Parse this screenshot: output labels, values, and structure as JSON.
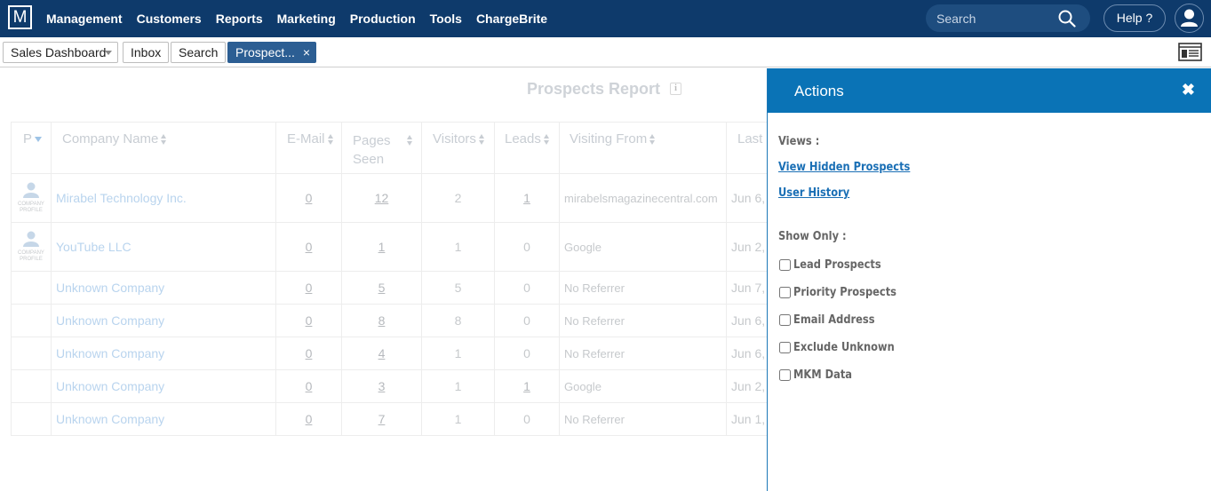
{
  "topbar": {
    "logo": "M",
    "nav": [
      "Management",
      "Customers",
      "Reports",
      "Marketing",
      "Production",
      "Tools",
      "ChargeBrite"
    ],
    "search_placeholder": "Search",
    "help_label": "Help ?"
  },
  "tabs": {
    "dropdown": "Sales Dashboard",
    "inbox": "Inbox",
    "search": "Search",
    "active": "Prospect...",
    "active_close": "×"
  },
  "report": {
    "title": "Prospects Report",
    "info": "i",
    "columns": [
      "P",
      "Company Name",
      "E-Mail",
      "Pages Seen",
      "Visitors",
      "Leads",
      "Visiting From",
      "Last"
    ],
    "profile_caption": [
      "COMPANY",
      "PROFILE"
    ],
    "rows": [
      {
        "company": "Mirabel Technology Inc.",
        "email": "0",
        "pages": "12",
        "visitors": "2",
        "leads": "1",
        "from": "mirabelsmagazinecentral.com",
        "date": "Jun 6,",
        "profile": true,
        "leads_link": true
      },
      {
        "company": "YouTube LLC",
        "email": "0",
        "pages": "1",
        "visitors": "1",
        "leads": "0",
        "from": "Google",
        "date": "Jun 2,",
        "profile": true,
        "leads_link": false
      },
      {
        "company": "Unknown Company",
        "email": "0",
        "pages": "5",
        "visitors": "5",
        "leads": "0",
        "from": "No Referrer",
        "date": "Jun 7,",
        "profile": false,
        "leads_link": false
      },
      {
        "company": "Unknown Company",
        "email": "0",
        "pages": "8",
        "visitors": "8",
        "leads": "0",
        "from": "No Referrer",
        "date": "Jun 6,",
        "profile": false,
        "leads_link": false
      },
      {
        "company": "Unknown Company",
        "email": "0",
        "pages": "4",
        "visitors": "1",
        "leads": "0",
        "from": "No Referrer",
        "date": "Jun 6,",
        "profile": false,
        "leads_link": false
      },
      {
        "company": "Unknown Company",
        "email": "0",
        "pages": "3",
        "visitors": "1",
        "leads": "1",
        "from": "Google",
        "date": "Jun 2,",
        "profile": false,
        "leads_link": true
      },
      {
        "company": "Unknown Company",
        "email": "0",
        "pages": "7",
        "visitors": "1",
        "leads": "0",
        "from": "No Referrer",
        "date": "Jun 1,",
        "profile": false,
        "leads_link": false
      }
    ]
  },
  "panel": {
    "title": "Actions",
    "close": "✖",
    "views_label": "Views :",
    "links": [
      "View Hidden Prospects",
      "User History"
    ],
    "show_only_label": "Show Only :",
    "options": [
      "Lead Prospects",
      "Priority Prospects",
      "Email Address",
      "Exclude Unknown",
      "MKM Data"
    ]
  },
  "colors": {
    "topbar": "#0e3a6b",
    "active_tab": "#2c5e93",
    "panel_header": "#0a73b6",
    "link": "#1a6fb5"
  }
}
